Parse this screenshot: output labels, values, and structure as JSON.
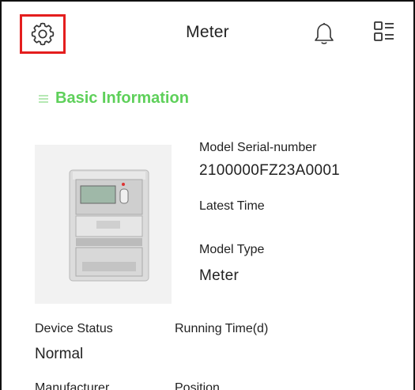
{
  "header": {
    "title": "Meter",
    "icons": [
      "gear-icon",
      "bell-icon",
      "grid-list-icon"
    ]
  },
  "section": {
    "title": "Basic Information"
  },
  "info": {
    "serial_label": "Model Serial-number",
    "serial_value": "2100000FZ23A0001",
    "latest_time_label": "Latest Time",
    "latest_time_value": "",
    "model_type_label": "Model Type",
    "model_type_value": "Meter"
  },
  "details": {
    "device_status_label": "Device Status",
    "device_status_value": "Normal",
    "running_time_label": "Running Time(d)",
    "running_time_value": "",
    "manufacturer_label": "Manufacturer",
    "position_label": "Position"
  },
  "colors": {
    "accent_green": "#5ed05a",
    "highlight_red": "#e41e1e"
  }
}
